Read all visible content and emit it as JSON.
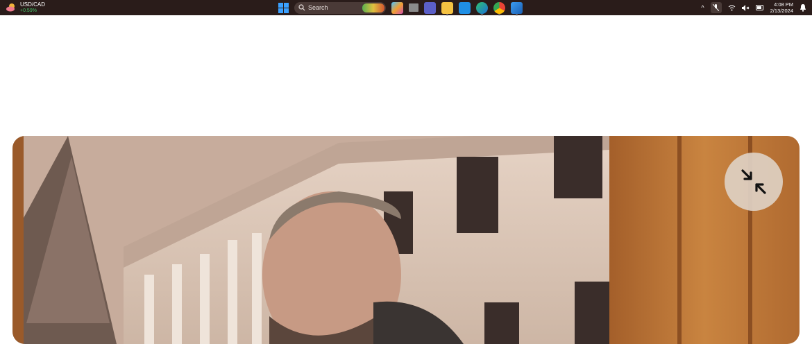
{
  "taskbar": {
    "ticker": {
      "symbol": "USD/CAD",
      "change": "+0.59%",
      "change_color": "#46c66b"
    },
    "search": {
      "label": "Search"
    },
    "apps": [
      "copilot-icon",
      "file-explorer-app-icon",
      "teams-icon",
      "folder-icon",
      "mail-icon",
      "edge-icon",
      "chrome-icon",
      "photos-icon"
    ],
    "clock": {
      "time": "4:08 PM",
      "date": "2/13/2024"
    }
  },
  "video": {
    "collapse_icon": "collapse-arrows-icon",
    "accent": "#d6c2b1"
  }
}
